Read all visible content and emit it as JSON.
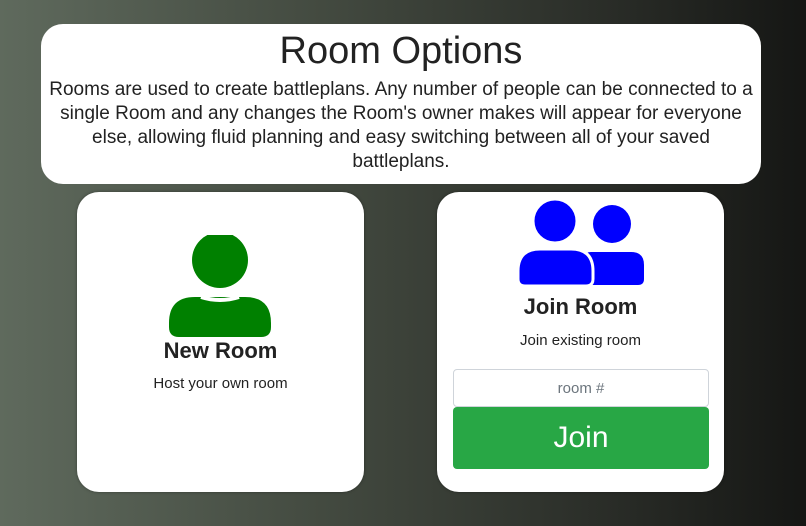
{
  "header": {
    "title": "Room Options",
    "description": "Rooms are used to create battleplans. Any number of people can be connected to a single Room and any changes the Room's owner makes will appear for everyone else, allowing fluid planning and easy switching between all of your saved battleplans."
  },
  "new_room": {
    "icon": "user-icon",
    "icon_color": "#008000",
    "title": "New Room",
    "subtitle": "Host your own room"
  },
  "join_room": {
    "icon": "users-icon",
    "icon_color": "#0000ff",
    "title": "Join Room",
    "subtitle": "Join existing room",
    "input_placeholder": "room #",
    "input_value": "",
    "button_label": "Join",
    "button_color": "#28a745"
  }
}
